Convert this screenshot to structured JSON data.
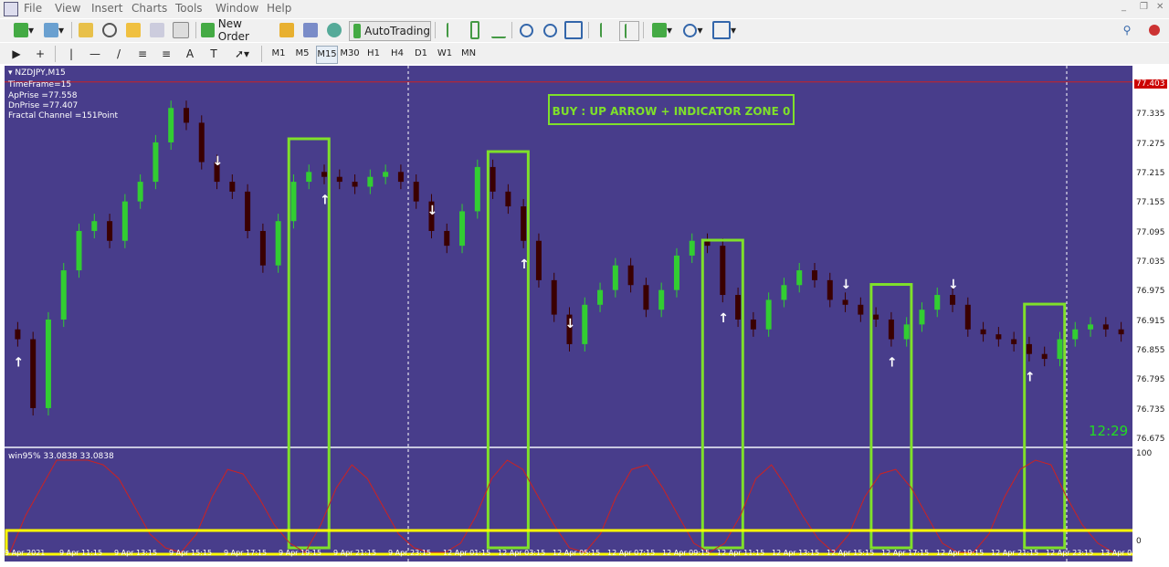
{
  "menu": [
    "File",
    "View",
    "Insert",
    "Charts",
    "Tools",
    "Window",
    "Help"
  ],
  "toolbar": {
    "new_order": "New Order",
    "autotrading": "AutoTrading",
    "timeframes": [
      "M1",
      "M5",
      "M15",
      "M30",
      "H1",
      "H4",
      "D1",
      "W1",
      "MN"
    ],
    "active_timeframe": "M15"
  },
  "chart": {
    "symbol": "NZDJPY,M15",
    "info_lines": [
      "TimeFrame=15",
      "ApPrise =77.558",
      "DnPrise =77.407",
      "Fractal Channel =151Point"
    ],
    "annotation": "BUY :  UP ARROW + INDICATOR ZONE 0",
    "clock": "12:29",
    "current_price": "77.403",
    "indicator_label": "win95% 33.0838 33.0838",
    "indicator_levels": [
      "100",
      "0"
    ],
    "price_ticks": [
      "77.395",
      "77.335",
      "77.275",
      "77.215",
      "77.155",
      "77.095",
      "77.035",
      "76.975",
      "76.915",
      "76.855",
      "76.795",
      "76.735",
      "76.675"
    ],
    "time_ticks": [
      "9 Apr 2021",
      "9 Apr 11:15",
      "9 Apr 13:15",
      "9 Apr 15:15",
      "9 Apr 17:15",
      "9 Apr 19:15",
      "9 Apr 21:15",
      "9 Apr 23:15",
      "12 Apr 01:15",
      "12 Apr 03:15",
      "12 Apr 05:15",
      "12 Apr 07:15",
      "12 Apr 09:15",
      "12 Apr 11:15",
      "12 Apr 13:15",
      "12 Apr 15:15",
      "12 Apr 17:15",
      "12 Apr 19:15",
      "12 Apr 21:15",
      "12 Apr 23:15",
      "13 Apr 01:15"
    ],
    "colors": {
      "background": "#483d8b",
      "bull": "#32cd32",
      "bear": "#3a0000",
      "frame": "#7fe02a",
      "zone": "#ffff00",
      "indicator": "#cc2222",
      "clock": "#22dd22"
    }
  },
  "chart_data": {
    "type": "candlestick",
    "symbol": "NZDJPY",
    "timeframe": "M15",
    "y_range": [
      76.675,
      77.395
    ],
    "closes": [
      76.88,
      76.74,
      76.92,
      77.02,
      77.1,
      77.12,
      77.08,
      77.16,
      77.2,
      77.28,
      77.35,
      77.32,
      77.24,
      77.2,
      77.18,
      77.1,
      77.03,
      77.12,
      77.2,
      77.22,
      77.21,
      77.2,
      77.19,
      77.21,
      77.22,
      77.2,
      77.16,
      77.1,
      77.07,
      77.14,
      77.23,
      77.18,
      77.15,
      77.08,
      77.0,
      76.93,
      76.87,
      76.95,
      76.98,
      77.03,
      76.99,
      76.94,
      76.98,
      77.05,
      77.08,
      77.07,
      76.97,
      76.92,
      76.9,
      76.96,
      76.99,
      77.02,
      77.0,
      76.96,
      76.95,
      76.93,
      76.92,
      76.88,
      76.91,
      76.94,
      76.97,
      76.95,
      76.9,
      76.89,
      76.88,
      76.87,
      76.85,
      76.84,
      76.88,
      76.9,
      76.91,
      76.9,
      76.89
    ],
    "buy_arrows": [
      0,
      20,
      33,
      46,
      57,
      66,
      74,
      82,
      90,
      98
    ],
    "sell_arrows": [
      13,
      27,
      36,
      54,
      61,
      85
    ],
    "zones": [
      19,
      32,
      46,
      57,
      67,
      81,
      94
    ],
    "indicator": [
      0,
      40,
      70,
      100,
      100,
      100,
      95,
      80,
      50,
      20,
      5,
      0,
      20,
      60,
      90,
      85,
      60,
      30,
      10,
      0,
      30,
      70,
      95,
      80,
      50,
      20,
      5,
      0,
      0,
      10,
      40,
      80,
      100,
      90,
      60,
      30,
      5,
      0,
      20,
      60,
      90,
      95,
      70,
      40,
      10,
      0,
      10,
      40,
      80,
      95,
      70,
      40,
      15,
      0,
      20,
      60,
      85,
      90,
      70,
      40,
      10,
      0,
      0,
      20,
      60,
      90,
      100,
      95,
      60,
      30,
      10,
      0
    ]
  }
}
